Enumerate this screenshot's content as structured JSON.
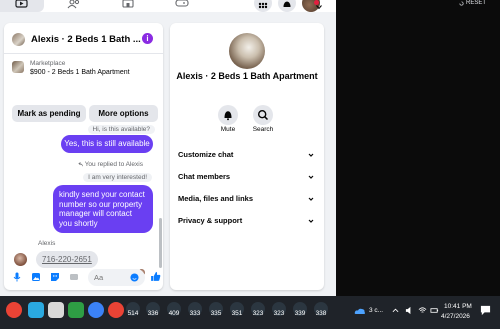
{
  "top_right": {
    "reset_label": "RESET"
  },
  "chat": {
    "title": "Alexis · 2 Beds 1 Bath ...",
    "listing": {
      "source": "Marketplace",
      "price_line": "$900 - 2 Beds 1 Bath Apartment"
    },
    "buttons": {
      "mark_pending": "Mark as pending",
      "more_options": "More options"
    },
    "messages": {
      "quoted_in": "Hi, is this available?",
      "out_1": "Yes, this is still available",
      "replied_note": "You replied to Alexis",
      "quoted_out": "I am very interested!",
      "out_2": "kindly send your contact number so our property manager will contact you shortly",
      "sender_name": "Alexis",
      "in_1": "716-220-2651"
    },
    "composer": {
      "placeholder": "Aa"
    }
  },
  "info_panel": {
    "title": "Alexis · 2 Beds 1 Bath Apartment",
    "actions": {
      "mute": "Mute",
      "search": "Search"
    },
    "sections": [
      "Customize chat",
      "Chat members",
      "Media, files and links",
      "Privacy & support"
    ]
  },
  "taskbar": {
    "badges": [
      "514",
      "336",
      "409",
      "333",
      "335",
      "351",
      "323",
      "323",
      "339",
      "338"
    ],
    "tray_label": "3 c...",
    "time": "10:41 PM",
    "date": "4/27/2026"
  },
  "colors": {
    "accent": "#6a3ff2",
    "info_purple": "#8a2be2",
    "like_blue": "#0a7cff"
  }
}
